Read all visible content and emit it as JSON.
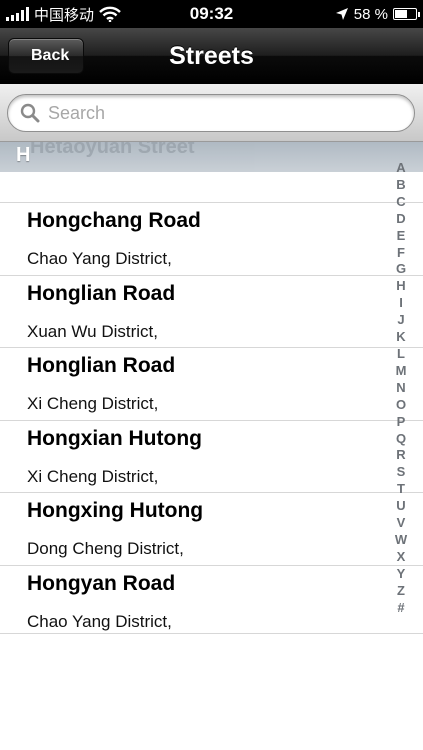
{
  "status_bar": {
    "carrier": "中国移动",
    "time": "09:32",
    "battery_percent": "58 %",
    "battery_level": 0.58,
    "icons": [
      "signal-icon",
      "wifi-icon",
      "location-arrow-icon",
      "battery-icon"
    ]
  },
  "nav_bar": {
    "back_label": "Back",
    "title": "Streets"
  },
  "search": {
    "placeholder": "Search"
  },
  "section": {
    "letter": "H",
    "ghost_text": "Hetaoyuan Street"
  },
  "rows": [
    {
      "title": "Hongchang Road",
      "subtitle": "Chao Yang District,"
    },
    {
      "title": "Honglian Road",
      "subtitle": "Xuan Wu District,"
    },
    {
      "title": "Honglian Road",
      "subtitle": "Xi Cheng District,"
    },
    {
      "title": "Hongxian Hutong",
      "subtitle": "Xi Cheng District,"
    },
    {
      "title": "Hongxing Hutong",
      "subtitle": "Dong Cheng District,"
    },
    {
      "title": "Hongyan Road",
      "subtitle": "Chao Yang District,"
    }
  ],
  "index_letters": [
    "A",
    "B",
    "C",
    "D",
    "E",
    "F",
    "G",
    "H",
    "I",
    "J",
    "K",
    "L",
    "M",
    "N",
    "O",
    "P",
    "Q",
    "R",
    "S",
    "T",
    "U",
    "V",
    "W",
    "X",
    "Y",
    "Z",
    "#"
  ],
  "colors": {
    "nav_background": "#000000",
    "index_text": "#6d7278",
    "section_header": "#b4bec8"
  }
}
